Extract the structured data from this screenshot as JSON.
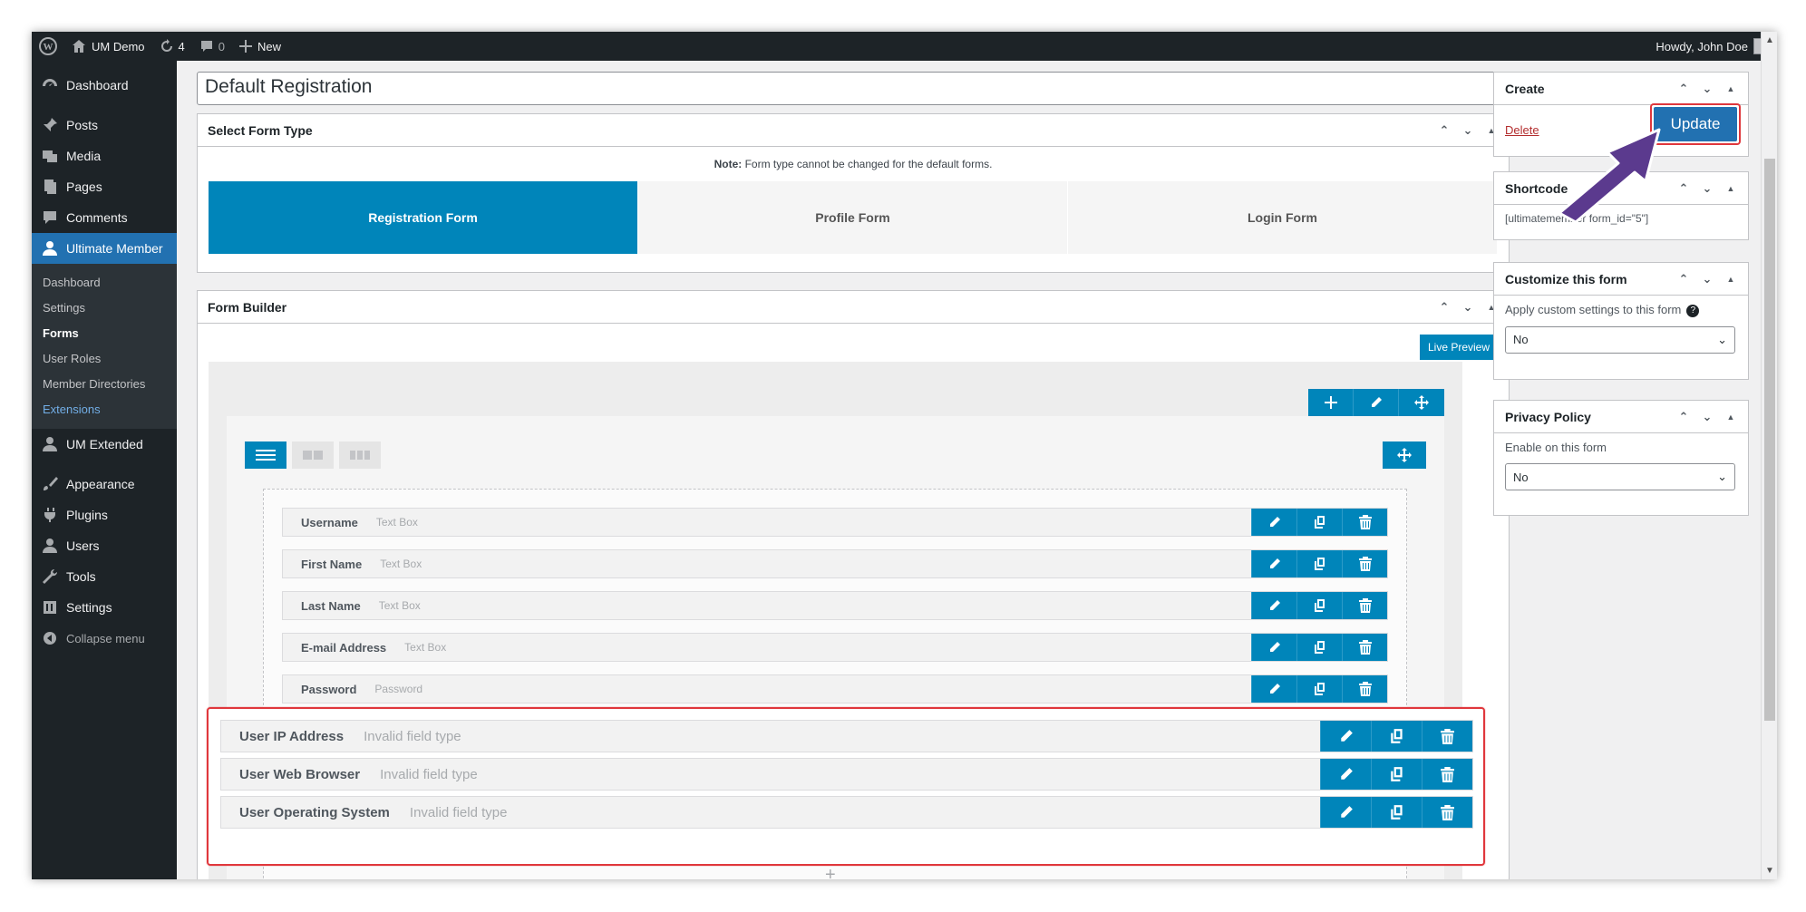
{
  "adminbar": {
    "site_name": "UM Demo",
    "updates_count": "4",
    "comments_count": "0",
    "new_label": "New",
    "howdy": "Howdy, John Doe"
  },
  "sidebar": {
    "items": [
      {
        "label": "Dashboard",
        "icon": "dashboard-icon"
      },
      {
        "label": "Posts",
        "icon": "pin-icon"
      },
      {
        "label": "Media",
        "icon": "media-icon"
      },
      {
        "label": "Pages",
        "icon": "pages-icon"
      },
      {
        "label": "Comments",
        "icon": "comment-icon"
      },
      {
        "label": "Ultimate Member",
        "icon": "user-icon"
      },
      {
        "label": "UM Extended",
        "icon": "user-icon"
      },
      {
        "label": "Appearance",
        "icon": "brush-icon"
      },
      {
        "label": "Plugins",
        "icon": "plugin-icon"
      },
      {
        "label": "Users",
        "icon": "users-icon"
      },
      {
        "label": "Tools",
        "icon": "wrench-icon"
      },
      {
        "label": "Settings",
        "icon": "settings-icon"
      }
    ],
    "submenu": [
      "Dashboard",
      "Settings",
      "Forms",
      "User Roles",
      "Member Directories",
      "Extensions"
    ],
    "collapse": "Collapse menu"
  },
  "main": {
    "title_value": "Default Registration",
    "select_form_type": {
      "header": "Select Form Type",
      "note_bold": "Note:",
      "note_text": " Form type cannot be changed for the default forms.",
      "types": [
        "Registration Form",
        "Profile Form",
        "Login Form"
      ]
    },
    "form_builder": {
      "header": "Form Builder",
      "live_preview": "Live Preview",
      "fields": [
        {
          "name": "Username",
          "type": "Text Box"
        },
        {
          "name": "First Name",
          "type": "Text Box"
        },
        {
          "name": "Last Name",
          "type": "Text Box"
        },
        {
          "name": "E-mail Address",
          "type": "Text Box"
        },
        {
          "name": "Password",
          "type": "Password"
        }
      ],
      "highlighted_fields": [
        {
          "name": "User IP Address",
          "type": "Invalid field type"
        },
        {
          "name": "User Web Browser",
          "type": "Invalid field type"
        },
        {
          "name": "User Operating System",
          "type": "Invalid field type"
        }
      ]
    }
  },
  "side": {
    "create": {
      "header": "Create",
      "delete": "Delete",
      "update": "Update"
    },
    "shortcode": {
      "header": "Shortcode",
      "value": "[ultimatemember form_id=\"5\"]"
    },
    "customize": {
      "header": "Customize this form",
      "label": "Apply custom settings to this form",
      "value": "No"
    },
    "privacy": {
      "header": "Privacy Policy",
      "label": "Enable on this form",
      "value": "No"
    }
  },
  "colors": {
    "accent": "#0085ba",
    "highlight": "#e0373c",
    "arrow": "#5b3a8e"
  }
}
